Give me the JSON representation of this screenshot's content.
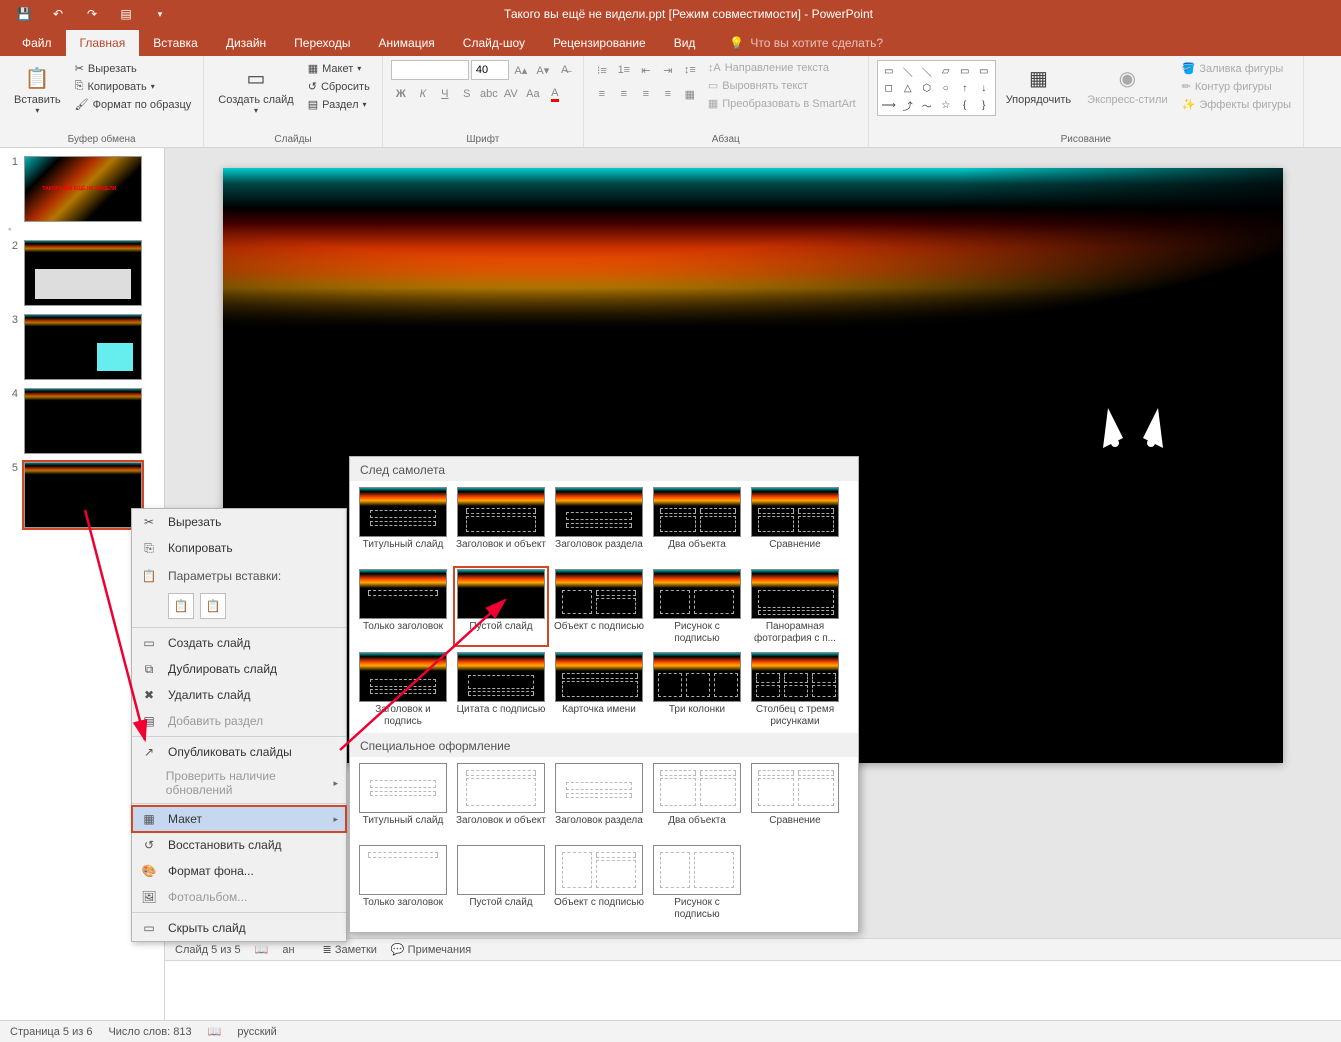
{
  "title": "Такого вы ещё не видели.ppt [Режим совместимости] - PowerPoint",
  "tabs": {
    "file": "Файл",
    "home": "Главная",
    "insert": "Вставка",
    "design": "Дизайн",
    "transitions": "Переходы",
    "animation": "Анимация",
    "slideshow": "Слайд-шоу",
    "review": "Рецензирование",
    "view": "Вид",
    "tellme": "Что вы хотите сделать?"
  },
  "ribbon": {
    "clipboard": {
      "paste": "Вставить",
      "cut": "Вырезать",
      "copy": "Копировать",
      "formatpainter": "Формат по образцу",
      "label": "Буфер обмена"
    },
    "slides": {
      "newslide": "Создать слайд",
      "layout": "Макет",
      "reset": "Сбросить",
      "section": "Раздел",
      "label": "Слайды"
    },
    "font": {
      "size": "40",
      "label": "Шрифт"
    },
    "paragraph": {
      "textdir": "Направление текста",
      "align": "Выровнять текст",
      "smartart": "Преобразовать в SmartArt",
      "label": "Абзац"
    },
    "drawing": {
      "arrange": "Упорядочить",
      "quickstyles": "Экспресс-стили",
      "shapefill": "Заливка фигуры",
      "shapeoutline": "Контур фигуры",
      "shapeeffects": "Эффекты фигуры",
      "label": "Рисование"
    }
  },
  "context_menu": {
    "cut": "Вырезать",
    "copy": "Копировать",
    "paste_header": "Параметры вставки:",
    "new_slide": "Создать слайд",
    "duplicate": "Дублировать слайд",
    "delete": "Удалить слайд",
    "add_section": "Добавить раздел",
    "publish": "Опубликовать слайды",
    "check_updates": "Проверить наличие обновлений",
    "layout": "Макет",
    "reset": "Восстановить слайд",
    "format_bg": "Формат фона...",
    "photo_album": "Фотоальбом...",
    "hide": "Скрыть слайд"
  },
  "layout_flyout": {
    "theme_name": "След самолета",
    "special_header": "Специальное оформление",
    "layouts_dark": [
      "Титульный слайд",
      "Заголовок и объект",
      "Заголовок раздела",
      "Два объекта",
      "Сравнение",
      "Только заголовок",
      "Пустой слайд",
      "Объект с подписью",
      "Рисунок с подписью",
      "Панорамная фотография с п...",
      "Заголовок и подпись",
      "Цитата с подписью",
      "Карточка имени",
      "Три колонки",
      "Столбец с тремя рисунками"
    ],
    "layouts_light": [
      "Титульный слайд",
      "Заголовок и объект",
      "Заголовок раздела",
      "Два объекта",
      "Сравнение",
      "Только заголовок",
      "Пустой слайд",
      "Объект с подписью",
      "Рисунок с подписью"
    ]
  },
  "statusbar": {
    "slide": "Слайд 5 из 5",
    "lang_short": "ан",
    "notes": "Заметки",
    "comments": "Примечания"
  },
  "bottom_status": {
    "page": "Страница 5 из 6",
    "words": "Число слов: 813",
    "lang": "русский"
  },
  "slides": [
    "1",
    "2",
    "3",
    "4",
    "5"
  ]
}
